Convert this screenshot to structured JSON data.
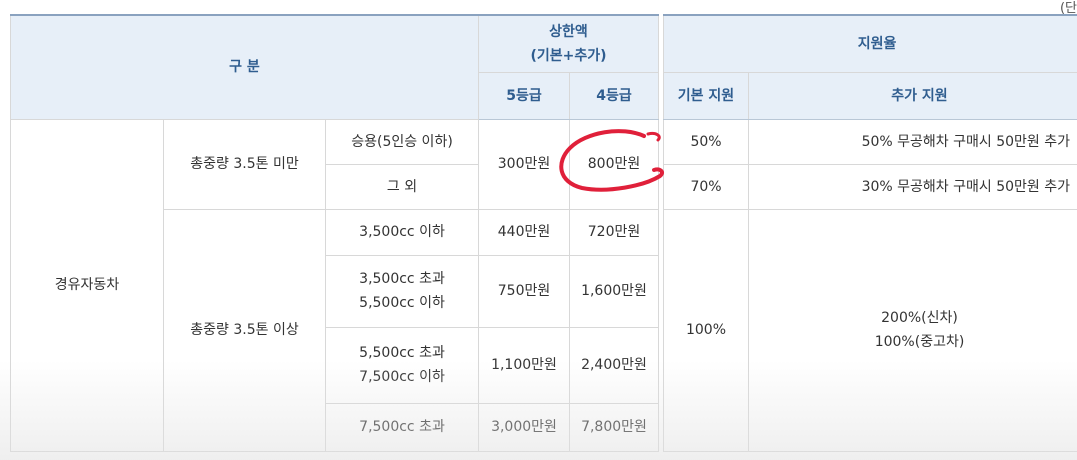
{
  "unit_note": "(단",
  "header": {
    "division": "구 분",
    "cap_title_line1": "상한액",
    "cap_title_line2": "(기본+추가)",
    "grade5": "5등급",
    "grade4": "4등급",
    "support_rate": "지원율",
    "basic_support": "기본 지원",
    "additional_support": "추가 지원"
  },
  "body": {
    "vehicle_type": "경유자동차",
    "under_group": {
      "label": "총중량 3.5톤 미만",
      "grade5_cap": "300만원",
      "grade4_cap": "800만원",
      "rows": [
        {
          "sub": "승용(5인승 이하)",
          "basic": "50%",
          "additional": "50% 무공해차 구매시 50만원 추가"
        },
        {
          "sub": "그 외",
          "basic": "70%",
          "additional": "30% 무공해차 구매시 50만원 추가"
        }
      ]
    },
    "over_group": {
      "label": "총중량 3.5톤 이상",
      "basic": "100%",
      "additional_line1": "200%(신차)",
      "additional_line2": "100%(중고차)",
      "rows": [
        {
          "sub_line1": "3,500cc 이하",
          "sub_line2": "",
          "grade5": "440만원",
          "grade4": "720만원"
        },
        {
          "sub_line1": "3,500cc 초과",
          "sub_line2": "5,500cc 이하",
          "grade5": "750만원",
          "grade4": "1,600만원"
        },
        {
          "sub_line1": "5,500cc 초과",
          "sub_line2": "7,500cc 이하",
          "grade5": "1,100만원",
          "grade4": "2,400만원"
        },
        {
          "sub_line1": "7,500cc 초과",
          "sub_line2": "",
          "grade5": "3,000만원",
          "grade4": "7,800만원"
        }
      ]
    }
  },
  "colors": {
    "header_bg": "#e7eff8",
    "header_text": "#2f5d8f",
    "annotation": "#e0203a"
  }
}
